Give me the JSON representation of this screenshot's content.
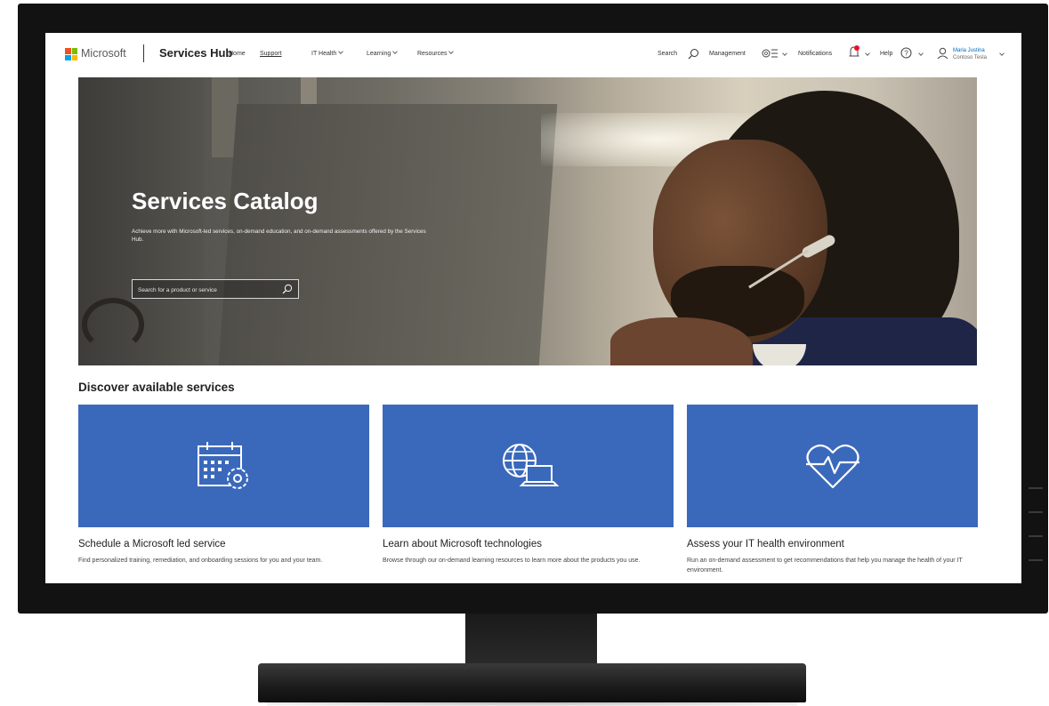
{
  "header": {
    "brand": "Microsoft",
    "product": "Services Hub",
    "nav": [
      {
        "label": "Home",
        "dropdown": false,
        "active": false
      },
      {
        "label": "Support",
        "dropdown": false,
        "active": true
      },
      {
        "label": "IT Health",
        "dropdown": true,
        "active": false
      },
      {
        "label": "Learning",
        "dropdown": true,
        "active": false
      },
      {
        "label": "Resources",
        "dropdown": true,
        "active": false
      }
    ],
    "utilities": {
      "search": "Search",
      "management": "Management",
      "notifications": "Notifications",
      "help": "Help"
    },
    "user": {
      "name": "Maria Justina",
      "org": "Contoso Tesla"
    }
  },
  "hero": {
    "title": "Services Catalog",
    "subtitle": "Achieve more with Microsoft-led services, on-demand education, and on-demand assessments offered by the Services Hub.",
    "search_placeholder": "Search for a product or service"
  },
  "section": {
    "title": "Discover available services"
  },
  "cards": [
    {
      "icon": "calendar-gear-icon",
      "title": "Schedule a Microsoft led service",
      "description": "Find personalized training, remediation, and onboarding sessions for you and your team."
    },
    {
      "icon": "globe-laptop-icon",
      "title": "Learn about Microsoft technologies",
      "description": "Browse through our on-demand learning resources to learn more about the products you use."
    },
    {
      "icon": "heart-pulse-icon",
      "title": "Assess your IT health environment",
      "description": "Run an on-demand assessment to get recommendations that help you manage the health of your IT environment."
    }
  ],
  "colors": {
    "card_blue": "#3a69bc",
    "link_blue": "#0067b8",
    "notification_dot": "#e81123",
    "logo_red": "#f25022",
    "logo_green": "#7fba00",
    "logo_blue": "#00a4ef",
    "logo_yellow": "#ffb900"
  }
}
